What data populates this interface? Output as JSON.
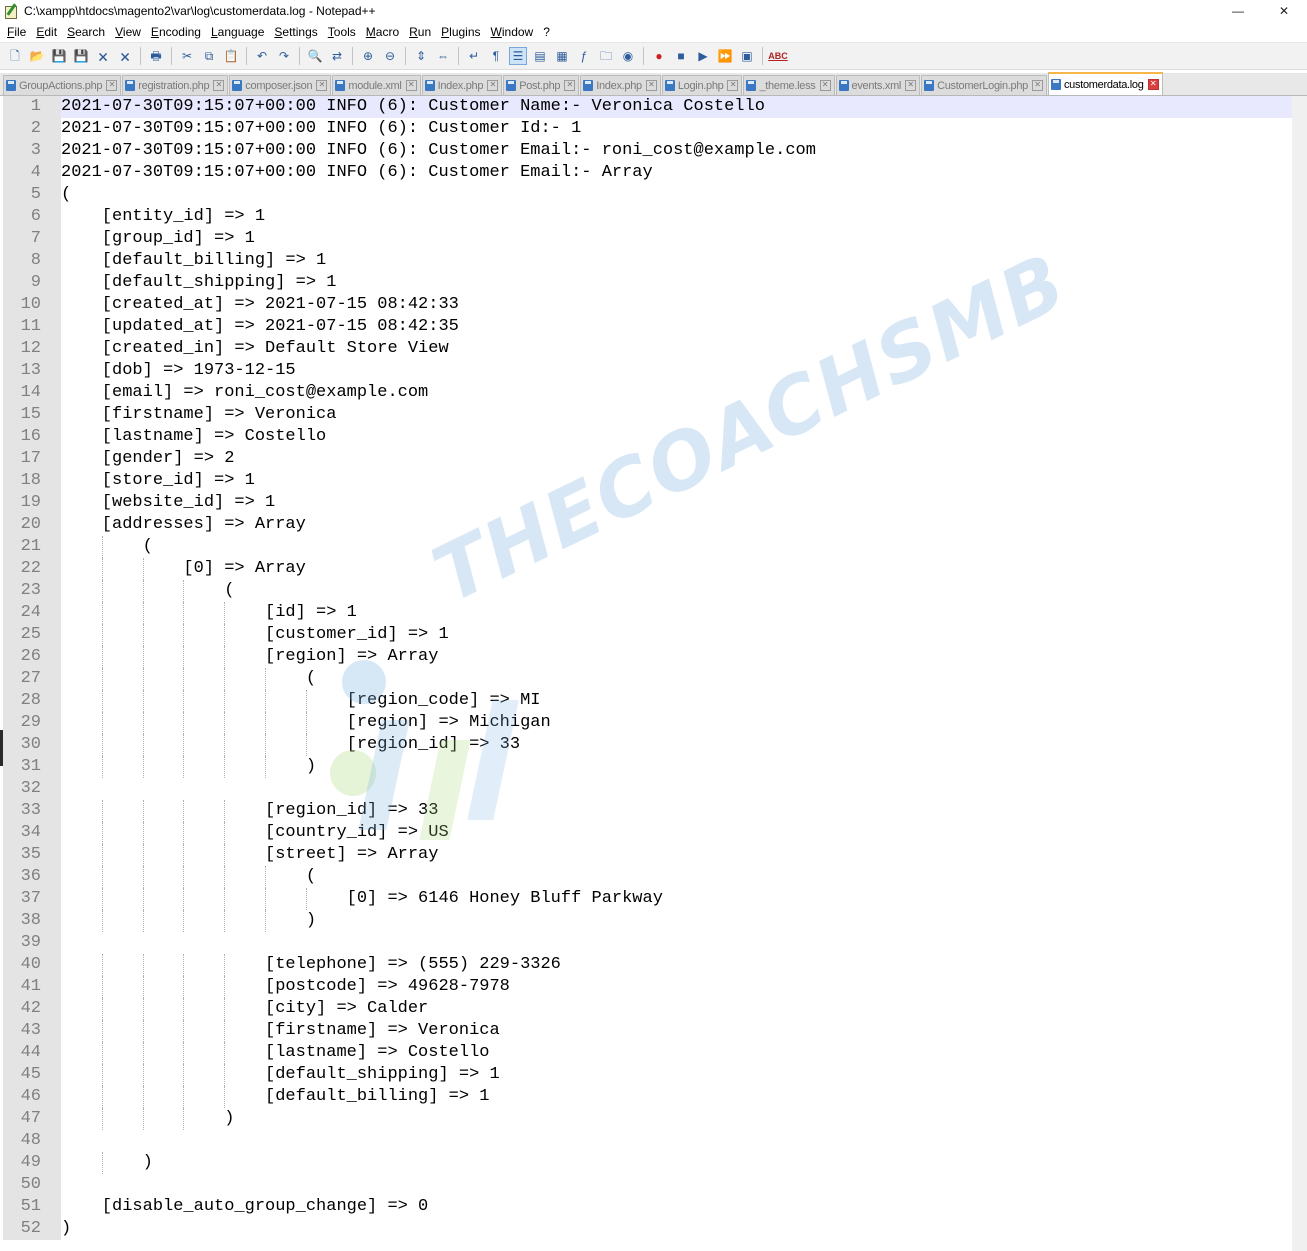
{
  "window": {
    "title": "C:\\xampp\\htdocs\\magento2\\var\\log\\customerdata.log - Notepad++",
    "minimize_label": "—",
    "close_label": "✕"
  },
  "menu": [
    "File",
    "Edit",
    "Search",
    "View",
    "Encoding",
    "Language",
    "Settings",
    "Tools",
    "Macro",
    "Run",
    "Plugins",
    "Window",
    "?"
  ],
  "toolbar": {
    "spellcheck_label": "ABC",
    "icons": [
      "new-file-icon",
      "open-file-icon",
      "save-icon",
      "save-all-icon",
      "close-icon",
      "close-all-icon",
      "print-icon",
      "cut-icon",
      "copy-icon",
      "paste-icon",
      "undo-icon",
      "redo-icon",
      "find-icon",
      "replace-icon",
      "zoom-in-icon",
      "zoom-out-icon",
      "sync-vertical-icon",
      "sync-horizontal-icon",
      "word-wrap-icon",
      "show-all-chars-icon",
      "indent-guide-icon",
      "udl-icon",
      "doc-map-icon",
      "function-list-icon",
      "folder-workspace-icon",
      "monitoring-icon",
      "record-macro-icon",
      "stop-record-icon",
      "play-macro-icon",
      "run-macro-multiple-icon",
      "save-macro-icon",
      "spellcheck-icon"
    ]
  },
  "tabs": [
    {
      "label": "GroupActions.php",
      "active": false
    },
    {
      "label": "registration.php",
      "active": false
    },
    {
      "label": "composer.json",
      "active": false
    },
    {
      "label": "module.xml",
      "active": false
    },
    {
      "label": "Index.php",
      "active": false
    },
    {
      "label": "Post.php",
      "active": false
    },
    {
      "label": "Index.php",
      "active": false
    },
    {
      "label": "Login.php",
      "active": false
    },
    {
      "label": "_theme.less",
      "active": false
    },
    {
      "label": "events.xml",
      "active": false
    },
    {
      "label": "CustomerLogin.php",
      "active": false
    },
    {
      "label": "customerdata.log",
      "active": true
    }
  ],
  "editor": {
    "current_line": 1,
    "lines": [
      "2021-07-30T09:15:07+00:00 INFO (6): Customer Name:- Veronica Costello",
      "2021-07-30T09:15:07+00:00 INFO (6): Customer Id:- 1",
      "2021-07-30T09:15:07+00:00 INFO (6): Customer Email:- roni_cost@example.com",
      "2021-07-30T09:15:07+00:00 INFO (6): Customer Email:- Array",
      "(",
      "    [entity_id] => 1",
      "    [group_id] => 1",
      "    [default_billing] => 1",
      "    [default_shipping] => 1",
      "    [created_at] => 2021-07-15 08:42:33",
      "    [updated_at] => 2021-07-15 08:42:35",
      "    [created_in] => Default Store View",
      "    [dob] => 1973-12-15",
      "    [email] => roni_cost@example.com",
      "    [firstname] => Veronica",
      "    [lastname] => Costello",
      "    [gender] => 2",
      "    [store_id] => 1",
      "    [website_id] => 1",
      "    [addresses] => Array",
      "        (",
      "            [0] => Array",
      "                (",
      "                    [id] => 1",
      "                    [customer_id] => 1",
      "                    [region] => Array",
      "                        (",
      "                            [region_code] => MI",
      "                            [region] => Michigan",
      "                            [region_id] => 33",
      "                        )",
      "",
      "                    [region_id] => 33",
      "                    [country_id] => US",
      "                    [street] => Array",
      "                        (",
      "                            [0] => 6146 Honey Bluff Parkway",
      "                        )",
      "",
      "                    [telephone] => (555) 229-3326",
      "                    [postcode] => 49628-7978",
      "                    [city] => Calder",
      "                    [firstname] => Veronica",
      "                    [lastname] => Costello",
      "                    [default_shipping] => 1",
      "                    [default_billing] => 1",
      "                )",
      "",
      "        )",
      "",
      "    [disable_auto_group_change] => 0",
      ")"
    ]
  },
  "watermark": {
    "text": "THECOACHSMB"
  }
}
